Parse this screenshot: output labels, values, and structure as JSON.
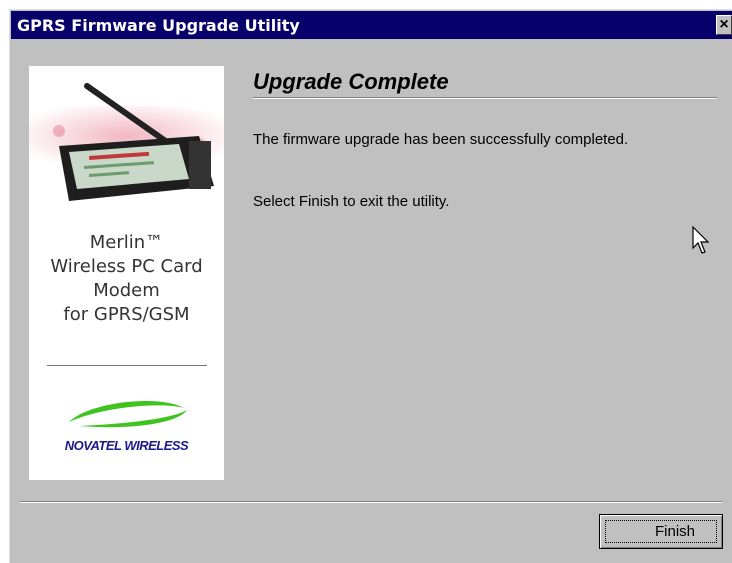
{
  "window": {
    "title": "GPRS Firmware Upgrade Utility",
    "close_glyph": "×"
  },
  "side_panel": {
    "product_lines": [
      "Merlin™",
      "Wireless PC Card",
      "Modem",
      "for GPRS/GSM"
    ],
    "brand": "NOVATEL WIRELESS"
  },
  "content": {
    "heading": "Upgrade Complete",
    "message_1": "The firmware upgrade has been successfully completed.",
    "message_2": "Select Finish to exit the utility."
  },
  "buttons": {
    "finish_label": "Finish"
  },
  "icons": {
    "close": "close-icon",
    "cursor": "mouse-pointer-icon",
    "logo": "novatel-swoosh-logo",
    "product": "pc-card-modem-image"
  },
  "colors": {
    "titlebar": "#08006a",
    "dialog_bg": "#c0c0c0",
    "brand_blue": "#1b1a8c",
    "logo_green": "#3fc31f"
  }
}
